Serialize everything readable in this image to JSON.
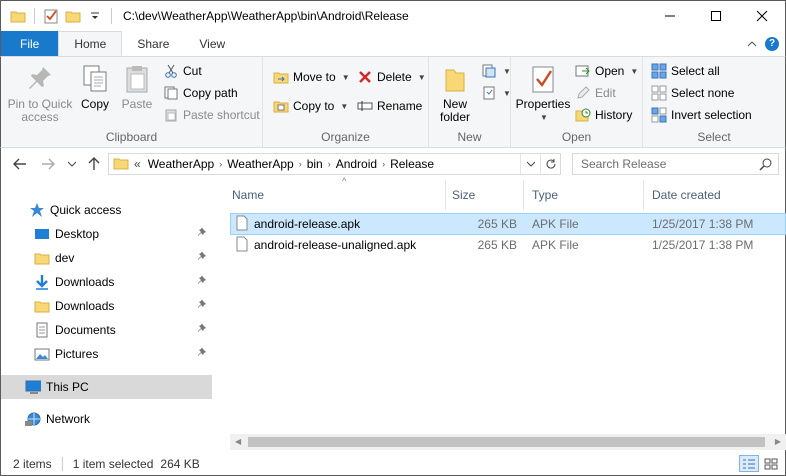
{
  "window": {
    "title": "C:\\dev\\WeatherApp\\WeatherApp\\bin\\Android\\Release",
    "minimize_icon": "minimize-icon",
    "maximize_icon": "maximize-icon",
    "close_icon": "close-icon"
  },
  "ribbon_tabs": [
    {
      "label": "File"
    },
    {
      "label": "Home"
    },
    {
      "label": "Share"
    },
    {
      "label": "View"
    }
  ],
  "ribbon": {
    "clipboard": {
      "label": "Clipboard",
      "pin_label_1": "Pin to Quick",
      "pin_label_2": "access",
      "copy": "Copy",
      "paste": "Paste",
      "cut": "Cut",
      "copy_path": "Copy path",
      "paste_shortcut": "Paste shortcut"
    },
    "organize": {
      "label": "Organize",
      "move_to": "Move to",
      "copy_to": "Copy to",
      "delete": "Delete",
      "rename": "Rename"
    },
    "new": {
      "label": "New",
      "new_folder_1": "New",
      "new_folder_2": "folder"
    },
    "open": {
      "label": "Open",
      "properties": "Properties",
      "open": "Open",
      "edit": "Edit",
      "history": "History"
    },
    "select": {
      "label": "Select",
      "select_all": "Select all",
      "select_none": "Select none",
      "invert_selection": "Invert selection"
    }
  },
  "address": {
    "overflow": "«",
    "breadcrumbs": [
      "WeatherApp",
      "WeatherApp",
      "bin",
      "Android",
      "Release"
    ],
    "search_placeholder": "Search Release"
  },
  "nav_pane": {
    "quick_access": "Quick access",
    "items": [
      {
        "label": "Desktop",
        "pinned": true
      },
      {
        "label": "dev",
        "pinned": true
      },
      {
        "label": "Downloads",
        "pinned": true
      },
      {
        "label": "Downloads",
        "pinned": true
      },
      {
        "label": "Documents",
        "pinned": true
      },
      {
        "label": "Pictures",
        "pinned": true
      }
    ],
    "this_pc": "This PC",
    "network": "Network"
  },
  "file_list": {
    "columns": [
      "Name",
      "Size",
      "Type",
      "Date created"
    ],
    "rows": [
      {
        "name": "android-release.apk",
        "size": "265 KB",
        "type": "APK File",
        "date": "1/25/2017 1:38 PM",
        "selected": true
      },
      {
        "name": "android-release-unaligned.apk",
        "size": "265 KB",
        "type": "APK File",
        "date": "1/25/2017 1:38 PM",
        "selected": false
      }
    ]
  },
  "status": {
    "items": "2 items",
    "selected": "1 item selected",
    "size": "264 KB"
  },
  "colors": {
    "file_tab": "#1979ca",
    "selection": "#cce8ff",
    "nav_selected": "#d9d9d9"
  }
}
